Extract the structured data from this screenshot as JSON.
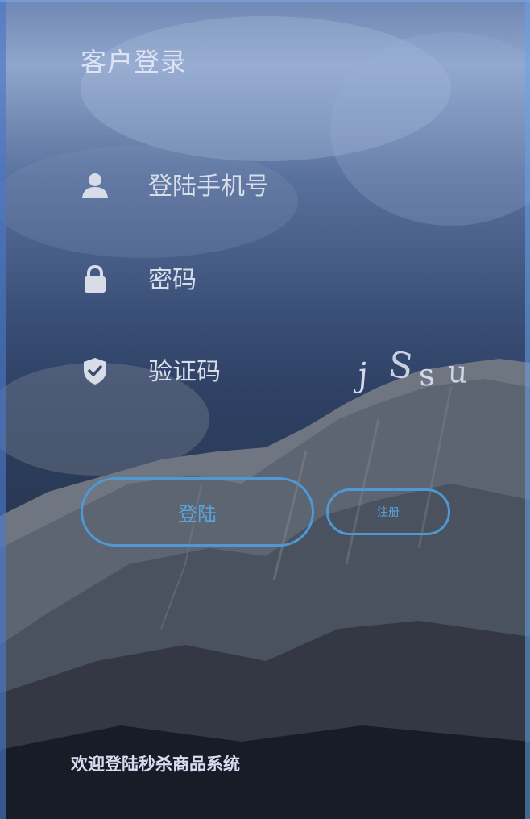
{
  "login": {
    "title": "客户登录",
    "phone": {
      "placeholder": "登陆手机号",
      "icon": "user-icon"
    },
    "password": {
      "placeholder": "密码",
      "icon": "lock-icon"
    },
    "code": {
      "placeholder": "验证码",
      "icon": "shield-check-icon"
    },
    "captcha": {
      "text": [
        "j",
        "S",
        "s",
        "u"
      ],
      "icon": "captcha-image"
    },
    "login_button": "登陆",
    "register_button": "注册",
    "footer": "欢迎登陆秒杀商品系统"
  },
  "colors": {
    "accent": "#4f98d3",
    "text_light": "#dde3f5",
    "icon_fill": "#d7dce8"
  }
}
